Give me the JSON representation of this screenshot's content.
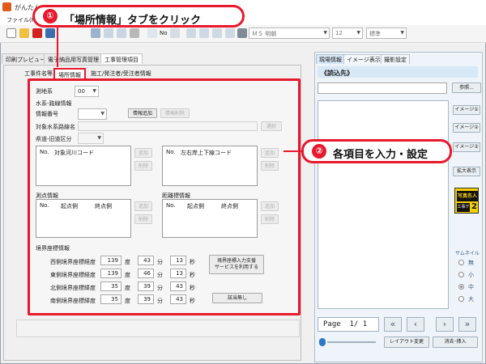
{
  "window": {
    "title": "がんたん"
  },
  "menu": {
    "file": "ファイル(F)"
  },
  "toolbar": {
    "no_label": "No",
    "font_combo": "ＭＳ 明朝",
    "size_combo": "12",
    "style_combo": "標準"
  },
  "main_tabs": [
    "印刷プレビュー",
    "電子納品用写真管理",
    "工事管理項目"
  ],
  "sub_tabs": [
    "工事件名等",
    "場所情報",
    "施工/発注者/受注者情報"
  ],
  "form": {
    "datum_label": "測地系",
    "datum_value": "00",
    "water_section": "水系-路線情報",
    "info_no_label": "情報番号",
    "info_add_btn": "情報追加",
    "info_del_btn": "情報削除",
    "river_label": "対象水系路線名",
    "river_select_btn": "選択",
    "pref_label": "県道-旧道区分",
    "grid1_headers": [
      "No.",
      "対象河川コード"
    ],
    "grid2_headers": [
      "No.",
      "左右岸上下線コード"
    ],
    "add_btn": "追加",
    "del_btn": "削除",
    "survey_section": "測点情報",
    "distance_section": "距離標情報",
    "grid3_headers": [
      "No.",
      "起点側",
      "終点側"
    ],
    "grid4_headers": [
      "No.",
      "起点側",
      "終点側"
    ],
    "boundary_section": "境界座標情報",
    "coords": [
      {
        "label": "西側境界座標経度",
        "deg": "139",
        "min": "43",
        "sec": "13"
      },
      {
        "label": "東側境界座標経度",
        "deg": "139",
        "min": "46",
        "sec": "13"
      },
      {
        "label": "北側境界座標緯度",
        "deg": "35",
        "min": "39",
        "sec": "43"
      },
      {
        "label": "南側境界座標緯度",
        "deg": "35",
        "min": "39",
        "sec": "43"
      }
    ],
    "unit_deg": "度",
    "unit_min": "分",
    "unit_sec": "秒",
    "boundary_support_btn": "境界座標入力支援\nサービスを利用する",
    "none_btn": "該当無し"
  },
  "right": {
    "tabs": [
      "現場情報",
      "イメージ表示",
      "撮影設定"
    ],
    "header": "《読込先》",
    "ref_btn": "参照...",
    "image_btns": [
      "イメージ①",
      "イメージ②",
      "イメージ③"
    ],
    "zoom_btn": "拡大表示",
    "badge_top": "写真名人",
    "badge_bottom": "工事デジ",
    "badge_num": "2",
    "thumb_label": "サムネイル",
    "thumb_options": [
      "無",
      "小",
      "中",
      "大"
    ],
    "thumb_selected": "中",
    "page_text": "Page  1/ 1",
    "layout_btn": "レイアウト変更",
    "delete_insert_btn": "消去･挿入"
  },
  "callouts": {
    "one_num": "①",
    "one_text": "「場所情報」タブをクリック",
    "two_num": "②",
    "two_text": "各項目を入力・設定"
  },
  "colors": {
    "accent_red": "#e8192c",
    "right_bg": "#eef4f9"
  }
}
